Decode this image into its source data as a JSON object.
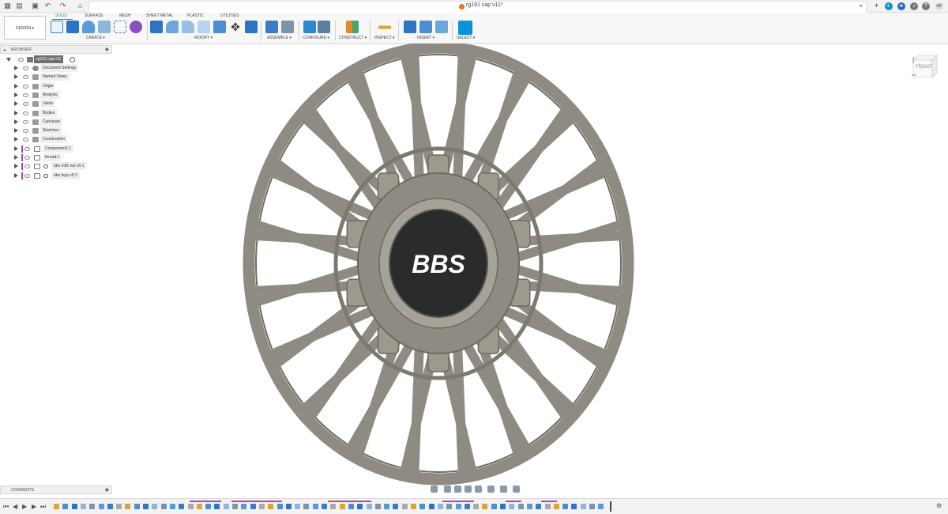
{
  "titlebar": {
    "document_title": "rg191 cap v11*",
    "user_initials": "GP"
  },
  "ribbon": {
    "workspace": "DESIGN",
    "tabs": [
      "SOLID",
      "SURFACE",
      "MESH",
      "SHEET METAL",
      "PLASTIC",
      "UTILITIES"
    ],
    "active_tab": "SOLID",
    "groups": [
      "CREATE",
      "MODIFY",
      "ASSEMBLE",
      "CONFIGURE",
      "CONSTRUCT",
      "INSPECT",
      "INSERT",
      "SELECT"
    ]
  },
  "browser": {
    "title": "BROWSER",
    "root": "rg191 cap v11",
    "items": [
      {
        "label": "Document Settings",
        "icon": "gear-icon"
      },
      {
        "label": "Named Views",
        "icon": "folder-icon"
      },
      {
        "label": "Origin",
        "icon": "folder-icon"
      },
      {
        "label": "Analysis",
        "icon": "folder-icon"
      },
      {
        "label": "Joints",
        "icon": "folder-icon"
      },
      {
        "label": "Bodies",
        "icon": "folder-icon"
      },
      {
        "label": "Canvases",
        "icon": "folder-icon"
      },
      {
        "label": "Sketches",
        "icon": "folder-icon"
      },
      {
        "label": "Construction",
        "icon": "folder-icon"
      },
      {
        "label": "Component1:1",
        "icon": "component-icon"
      },
      {
        "label": "thread:1",
        "icon": "component-icon"
      },
      {
        "label": "bbs m55 nut v5:1",
        "icon": "link-icon"
      },
      {
        "label": "bbs logo v5:1",
        "icon": "link-icon"
      }
    ]
  },
  "comments": {
    "title": "COMMENTS"
  },
  "viewcube": {
    "face_label": "FRONT"
  },
  "model": {
    "logo_text": "BBS"
  },
  "colors": {
    "accent": "#0696d7",
    "timeline_marker": "#b0469e",
    "model_grey": "#8f8b82"
  }
}
